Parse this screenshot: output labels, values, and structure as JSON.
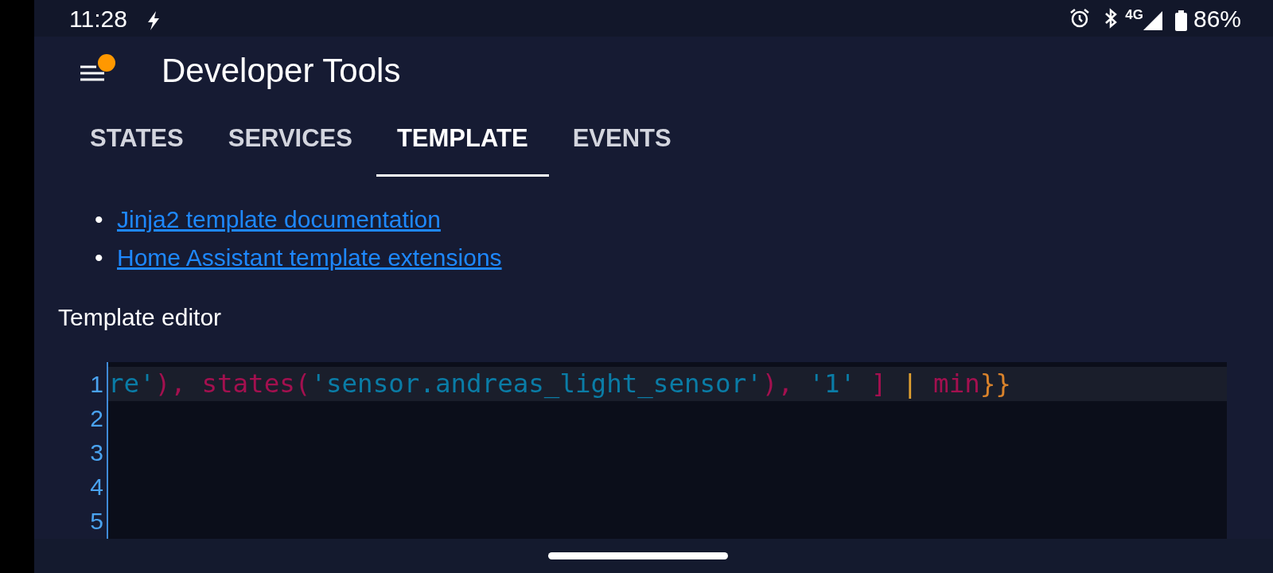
{
  "status_bar": {
    "time": "11:28",
    "network": "4G",
    "battery": "86%"
  },
  "app_bar": {
    "title": "Developer Tools",
    "menu_badge": true
  },
  "tabs": [
    {
      "label": "STATES",
      "selected": false
    },
    {
      "label": "SERVICES",
      "selected": false
    },
    {
      "label": "TEMPLATE",
      "selected": true
    },
    {
      "label": "EVENTS",
      "selected": false
    }
  ],
  "links": [
    {
      "bullet": "•",
      "text": "Jinja2 template documentation"
    },
    {
      "bullet": "•",
      "text": "Home Assistant template extensions"
    }
  ],
  "editor": {
    "label": "Template editor",
    "lines": [
      {
        "number": "1",
        "active": true,
        "tokens": [
          {
            "kind": "string",
            "text": "re'"
          },
          {
            "kind": "punct",
            "text": "), states("
          },
          {
            "kind": "string",
            "text": "'sensor.andreas_light_sensor'"
          },
          {
            "kind": "punct",
            "text": "), "
          },
          {
            "kind": "string",
            "text": "'1'"
          },
          {
            "kind": "punct",
            "text": " ] "
          },
          {
            "kind": "operator",
            "text": "|"
          },
          {
            "kind": "punct",
            "text": " min"
          },
          {
            "kind": "brace",
            "text": "}}"
          }
        ]
      },
      {
        "number": "2",
        "active": false
      },
      {
        "number": "3",
        "active": false
      },
      {
        "number": "4",
        "active": false
      },
      {
        "number": "5",
        "active": false
      }
    ]
  }
}
